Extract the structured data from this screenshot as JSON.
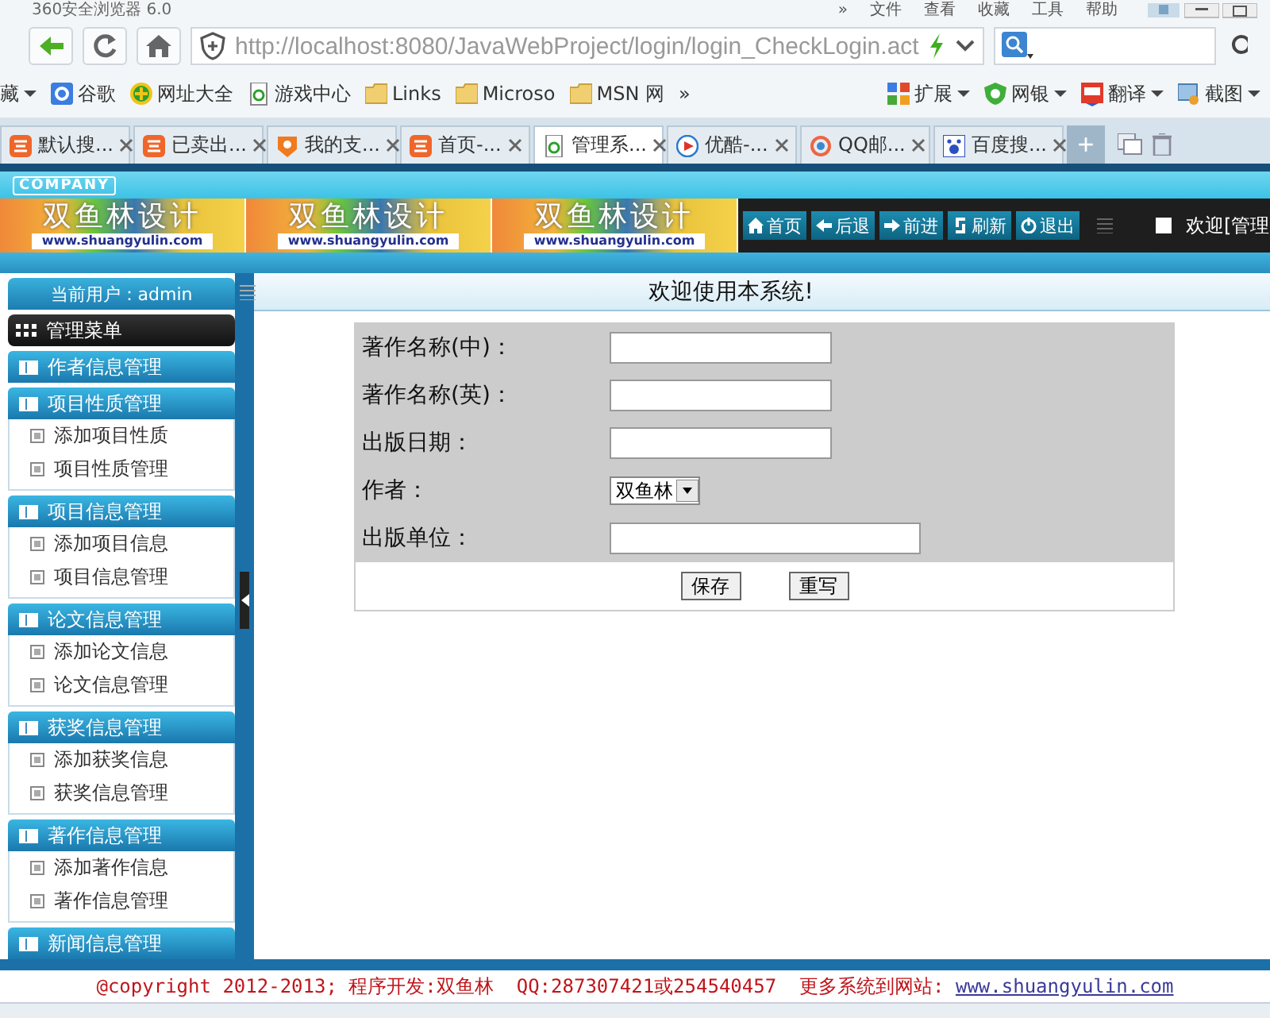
{
  "browser": {
    "title": "360安全浏览器 6.0",
    "menu": [
      "»",
      "文件",
      "查看",
      "收藏",
      "工具",
      "帮助"
    ],
    "url": "http://localhost:8080/JavaWebProject/login/login_CheckLogin.act",
    "bookmarks_left": [
      {
        "label": "藏",
        "kind": "partial"
      },
      {
        "label": "谷歌",
        "kind": "google"
      },
      {
        "label": "网址大全",
        "kind": "plus"
      },
      {
        "label": "游戏中心",
        "kind": "page"
      },
      {
        "label": "Links",
        "kind": "folder"
      },
      {
        "label": "Microso",
        "kind": "folder"
      },
      {
        "label": "MSN 网",
        "kind": "folder"
      },
      {
        "label": "»",
        "kind": "more"
      }
    ],
    "bookmarks_right": [
      {
        "label": "扩展",
        "kind": "apps"
      },
      {
        "label": "网银",
        "kind": "shield"
      },
      {
        "label": "翻译",
        "kind": "translate"
      },
      {
        "label": "截图",
        "kind": "screenshot"
      }
    ],
    "tabs": [
      {
        "label": "默认搜...",
        "kind": "taobao",
        "selected": false
      },
      {
        "label": "已卖出...",
        "kind": "taobao",
        "selected": false
      },
      {
        "label": "我的支...",
        "kind": "alipay",
        "selected": false
      },
      {
        "label": "首页-...",
        "kind": "taobao",
        "selected": false
      },
      {
        "label": "管理系...",
        "kind": "page",
        "selected": true
      },
      {
        "label": "优酷-...",
        "kind": "play",
        "selected": false
      },
      {
        "label": "QQ邮...",
        "kind": "ring",
        "selected": false
      },
      {
        "label": "百度搜...",
        "kind": "paw",
        "selected": false
      }
    ],
    "new_tab": "+"
  },
  "page": {
    "company": "COMPANY",
    "logos": [
      {
        "title": "双鱼林设计",
        "url": "www.shuangyulin.com"
      },
      {
        "title": "双鱼林设计",
        "url": "www.shuangyulin.com"
      },
      {
        "title": "双鱼林设计",
        "url": "www.shuangyulin.com"
      }
    ],
    "nav": [
      {
        "label": "首页",
        "kind": "home"
      },
      {
        "label": "后退",
        "kind": "back"
      },
      {
        "label": "前进",
        "kind": "forward"
      },
      {
        "label": "刷新",
        "kind": "refresh"
      },
      {
        "label": "退出",
        "kind": "power"
      }
    ],
    "welcome": "欢迎[管理",
    "current_user": "当前用户：admin",
    "menu_title": "管理菜单",
    "menu": [
      {
        "label": "作者信息管理"
      },
      {
        "label": "项目性质管理",
        "children": [
          {
            "label": "添加项目性质"
          },
          {
            "label": "项目性质管理"
          }
        ]
      },
      {
        "label": "项目信息管理",
        "children": [
          {
            "label": "添加项目信息"
          },
          {
            "label": "项目信息管理"
          }
        ]
      },
      {
        "label": "论文信息管理",
        "children": [
          {
            "label": "添加论文信息"
          },
          {
            "label": "论文信息管理"
          }
        ]
      },
      {
        "label": "获奖信息管理",
        "children": [
          {
            "label": "添加获奖信息"
          },
          {
            "label": "获奖信息管理"
          }
        ]
      },
      {
        "label": "著作信息管理",
        "children": [
          {
            "label": "添加著作信息"
          },
          {
            "label": "著作信息管理"
          }
        ]
      },
      {
        "label": "新闻信息管理"
      }
    ],
    "content_title": "欢迎使用本系统!",
    "form": {
      "fields": [
        {
          "label": "著作名称(中)：",
          "kind": "text"
        },
        {
          "label": "著作名称(英)：",
          "kind": "text"
        },
        {
          "label": "出版日期：",
          "kind": "text"
        },
        {
          "label": "作者：",
          "kind": "select",
          "value": "双鱼林"
        },
        {
          "label": "出版单位：",
          "kind": "wide"
        }
      ],
      "buttons": [
        "保存",
        "重写"
      ]
    },
    "footer": {
      "text": "@copyright 2012-2013; 程序开发:双鱼林  QQ:287307421或254540457  更多系统到网站: ",
      "link": "www.shuangyulin.com"
    }
  }
}
